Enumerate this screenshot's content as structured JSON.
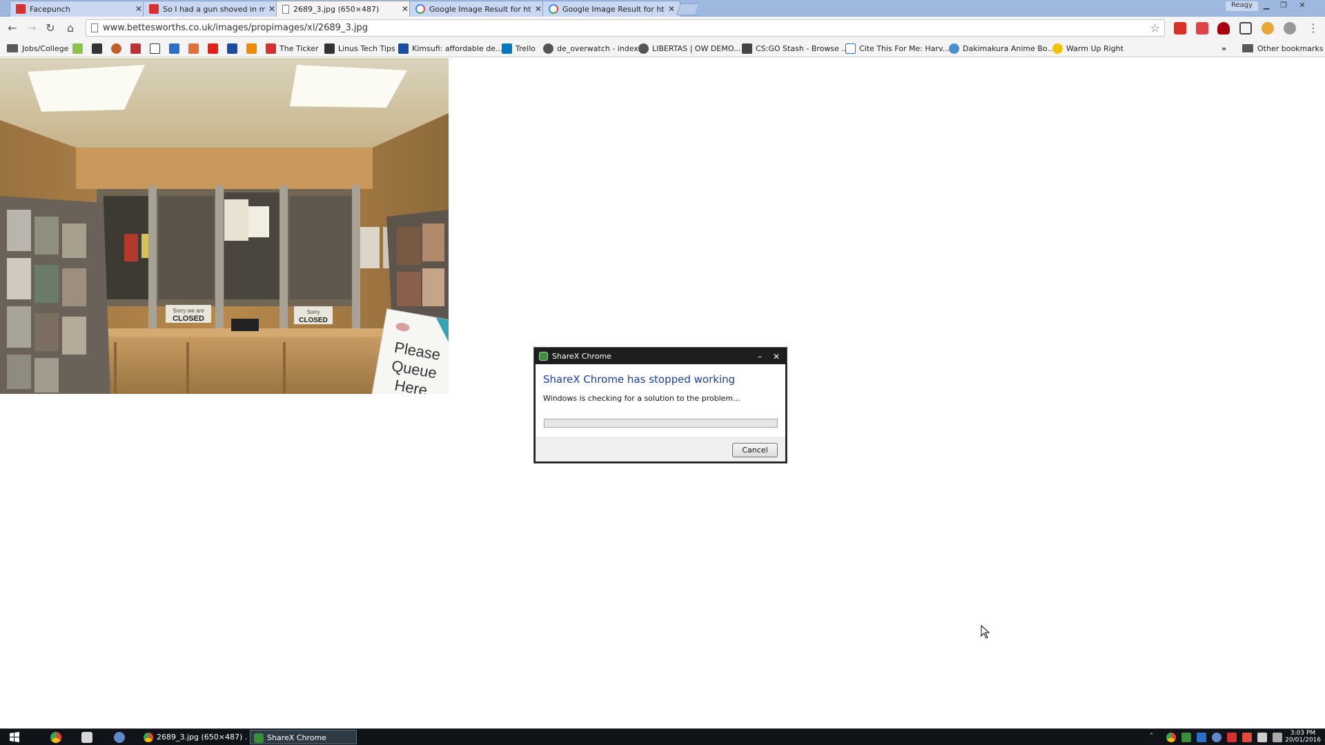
{
  "browser": {
    "tabs": [
      {
        "title": "Facepunch",
        "active": false,
        "favicon": "facepunch-icon"
      },
      {
        "title": "So I had a gun shoved in my",
        "active": false,
        "favicon": "facepunch-icon"
      },
      {
        "title": "2689_3.jpg (650×487)",
        "active": true,
        "favicon": "page-icon"
      },
      {
        "title": "Google Image Result for http",
        "active": false,
        "favicon": "google-icon"
      },
      {
        "title": "Google Image Result for http",
        "active": false,
        "favicon": "google-icon"
      }
    ],
    "profile_name": "Reagy",
    "url": "www.bettesworths.co.uk/images/propimages/xl/2689_3.jpg",
    "bookmarks": [
      {
        "label": "Jobs/College",
        "type": "folder"
      },
      {
        "label": "The Ticker"
      },
      {
        "label": "Linus Tech Tips"
      },
      {
        "label": "Kimsufi: affordable de..."
      },
      {
        "label": "Trello"
      },
      {
        "label": "de_overwatch - index"
      },
      {
        "label": "LIBERTAS | OW DEMO..."
      },
      {
        "label": "CS:GO Stash - Browse ..."
      },
      {
        "label": "Cite This For Me: Harv..."
      },
      {
        "label": "Dakimakura Anime Bo..."
      },
      {
        "label": "Warm Up Right"
      }
    ],
    "other_bookmarks": "Other bookmarks",
    "overflow": "»"
  },
  "photo": {
    "signs": {
      "closed_left_line1": "Sorry we are",
      "closed_left_line2": "CLOSED",
      "closed_right_line1": "Sorry",
      "closed_right_line2": "CLOSED",
      "queue_line1": "Please",
      "queue_line2": "Queue",
      "queue_line3": "Here"
    }
  },
  "dialog": {
    "window_title": "ShareX Chrome",
    "heading": "ShareX Chrome has stopped working",
    "message": "Windows is checking for a solution to the problem...",
    "progress": 0,
    "cancel_label": "Cancel"
  },
  "taskbar": {
    "tasks": [
      {
        "label": "2689_3.jpg (650×487) ...",
        "active": false
      },
      {
        "label": "ShareX Chrome",
        "active": true
      }
    ],
    "time": "3:03 PM",
    "date": "20/01/2016"
  },
  "colors": {
    "dialog_heading": "#1c3fa0",
    "tab_strip": "#9fb8e0",
    "taskbar": "#101418"
  }
}
